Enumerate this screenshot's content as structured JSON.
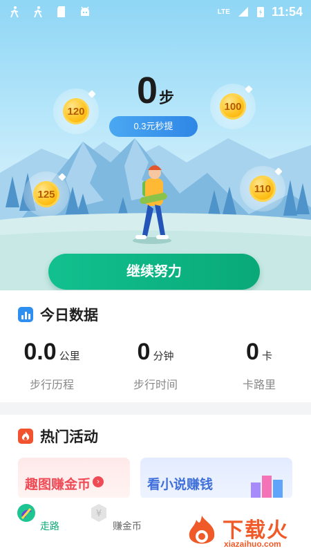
{
  "status_bar": {
    "time": "11:54",
    "network": "LTE"
  },
  "hero": {
    "steps_value": "0",
    "steps_unit": "步",
    "withdraw_pill": "0.3元秒提",
    "coins": [
      "120",
      "100",
      "125",
      "110"
    ],
    "cta_label": "继续努力"
  },
  "today_data": {
    "title": "今日数据",
    "metrics": [
      {
        "value": "0.0",
        "unit": "公里",
        "label": "步行历程"
      },
      {
        "value": "0",
        "unit": "分钟",
        "label": "步行时间"
      },
      {
        "value": "0",
        "unit": "卡",
        "label": "卡路里"
      }
    ]
  },
  "hot_activity": {
    "title": "热门活动",
    "items": [
      {
        "label": "趣图赚金币"
      },
      {
        "label": "看小说赚钱"
      }
    ]
  },
  "bottom_nav": {
    "items": [
      {
        "label": "走路",
        "icon": "walk-icon",
        "active": true
      },
      {
        "label": "赚金币",
        "icon": "coin-yen-icon",
        "active": false
      }
    ]
  },
  "watermark": {
    "text": "下载火",
    "url_text": "xiazaihuo.com"
  },
  "colors": {
    "accent_green": "#09b07f",
    "pill_blue": "#2f86e6",
    "coin_gold": "#ffc21c",
    "watermark_orange": "#f05a28"
  }
}
